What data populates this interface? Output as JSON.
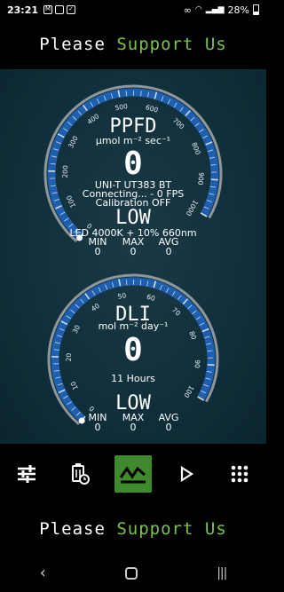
{
  "status": {
    "time": "23:21",
    "left_icons": [
      "mail-icon",
      "image-icon",
      "check-icon"
    ],
    "right_icons": [
      "link-icon",
      "wifi-icon",
      "signal-icon"
    ],
    "battery": "28%"
  },
  "banner": {
    "word1": "Please",
    "word2": "Support Us"
  },
  "ppfd": {
    "title": "PPFD",
    "unit": "µmol m⁻² sec⁻¹",
    "value": "0",
    "device": "UNI-T UT383 BT",
    "connection": "Connecting... - 0 FPS",
    "calibration": "Calibration OFF",
    "level": "LOW",
    "light": "LED 4000K + 10% 660nm",
    "ticks": [
      "0",
      "100",
      "200",
      "300",
      "400",
      "500",
      "600",
      "700",
      "800",
      "900",
      "1000"
    ],
    "min_label": "MIN",
    "max_label": "MAX",
    "avg_label": "AVG",
    "min": "0",
    "max": "0",
    "avg": "0"
  },
  "dli": {
    "title": "DLI",
    "unit": "mol m⁻² day⁻¹",
    "value": "0",
    "hours": "11 Hours",
    "level": "LOW",
    "ticks": [
      "0",
      "10",
      "20",
      "30",
      "40",
      "50",
      "60",
      "70",
      "80",
      "90",
      "100"
    ],
    "min_label": "MIN",
    "max_label": "MAX",
    "avg_label": "AVG",
    "min": "0",
    "max": "0",
    "avg": "0"
  },
  "toolbar": {
    "items": [
      "sliders-icon",
      "timer-icon",
      "chart-icon",
      "play-icon",
      "grid-icon"
    ],
    "active": "chart-icon"
  },
  "colors": {
    "accent_green": "#7cc24b",
    "arc_blue": "#1f5fb0",
    "active_green": "#3f8a2e"
  }
}
